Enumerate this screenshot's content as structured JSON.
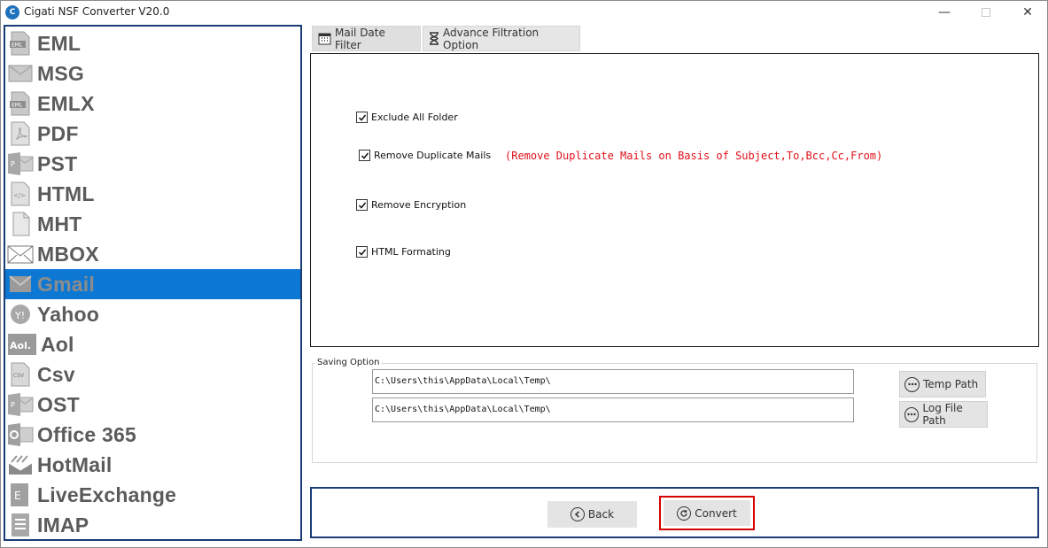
{
  "window": {
    "title": "Cigati NSF Converter V20.0",
    "icon_letter": "C",
    "controls": {
      "minimize": "—",
      "close": "✕"
    }
  },
  "sidebar": {
    "selected_index": 8,
    "items": [
      {
        "label": "EML",
        "icon": "eml-file-icon"
      },
      {
        "label": "MSG",
        "icon": "envelope-icon"
      },
      {
        "label": "EMLX",
        "icon": "emlx-file-icon"
      },
      {
        "label": "PDF",
        "icon": "pdf-file-icon"
      },
      {
        "label": "PST",
        "icon": "pst-outlook-icon"
      },
      {
        "label": "HTML",
        "icon": "html-file-icon"
      },
      {
        "label": "MHT",
        "icon": "mht-file-icon"
      },
      {
        "label": "MBOX",
        "icon": "mbox-envelope-icon"
      },
      {
        "label": "Gmail",
        "icon": "gmail-icon"
      },
      {
        "label": "Yahoo",
        "icon": "yahoo-icon"
      },
      {
        "label": "Aol",
        "icon": "aol-icon"
      },
      {
        "label": "Csv",
        "icon": "csv-file-icon"
      },
      {
        "label": "OST",
        "icon": "ost-outlook-icon"
      },
      {
        "label": "Office 365",
        "icon": "office365-icon"
      },
      {
        "label": "HotMail",
        "icon": "hotmail-icon"
      },
      {
        "label": "LiveExchange",
        "icon": "exchange-icon"
      },
      {
        "label": "IMAP",
        "icon": "imap-icon"
      }
    ]
  },
  "tabs": {
    "date_filter": "Mail Date Filter",
    "advance_filter": "Advance Filtration Option"
  },
  "options": {
    "exclude_all_folder": {
      "label": "Exclude All Folder",
      "checked": true
    },
    "remove_duplicate": {
      "label": "Remove Duplicate Mails",
      "checked": true
    },
    "duplicate_note": "(Remove Duplicate Mails on  Basis of Subject,To,Bcc,Cc,From)",
    "remove_encryption": {
      "label": "Remove Encryption",
      "checked": true
    },
    "html_formatting": {
      "label": "HTML Formating",
      "checked": true
    }
  },
  "saving": {
    "legend": "Saving Option",
    "temp_path_value": "C:\\Users\\this\\AppData\\Local\\Temp\\",
    "log_path_value": "C:\\Users\\this\\AppData\\Local\\Temp\\",
    "temp_path_button": "Temp Path",
    "log_path_button": "Log File Path"
  },
  "actions": {
    "back_label": "Back",
    "convert_label": "Convert"
  },
  "colors": {
    "selected_bg": "#0c78d3",
    "border_blue": "#1a3d78",
    "highlight_red": "#d60000",
    "note_red": "#e0101a"
  }
}
